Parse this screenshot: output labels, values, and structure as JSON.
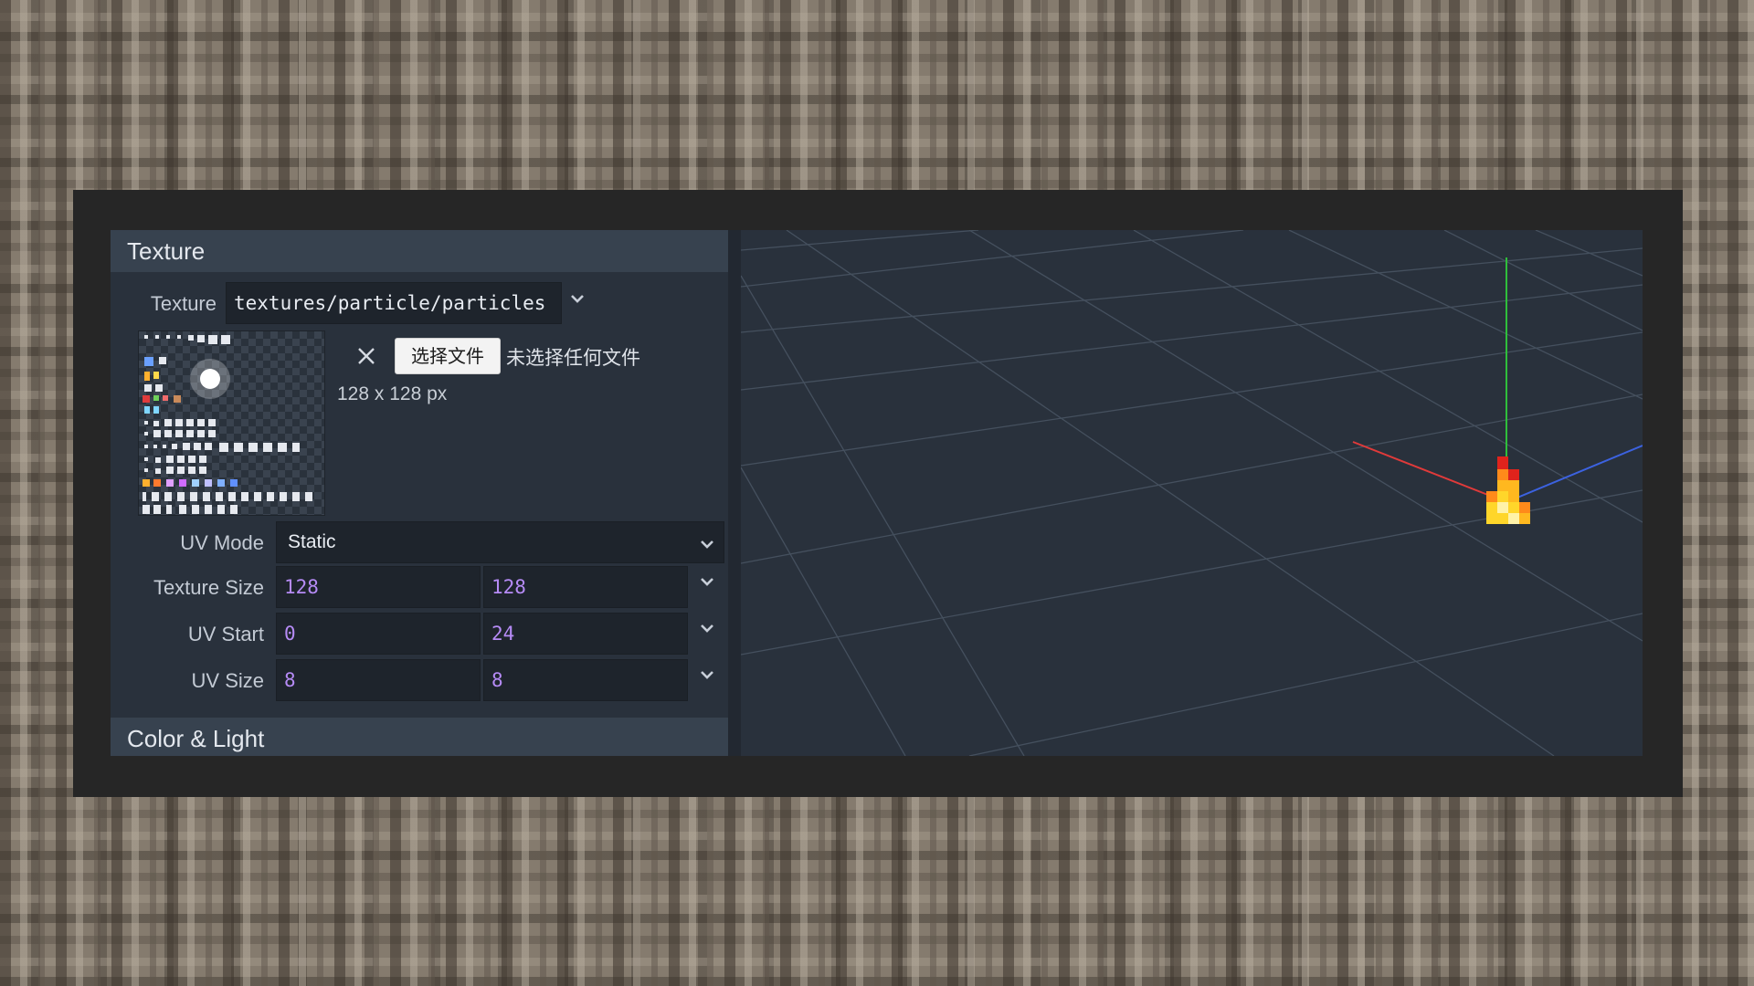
{
  "panel": {
    "texture_section_title": "Texture",
    "color_section_title": "Color & Light",
    "texture": {
      "label": "Texture",
      "value": "textures/particle/particles",
      "file_button": "选择文件",
      "file_status": "未选择任何文件",
      "size_text": "128 x 128 px"
    },
    "uv_mode": {
      "label": "UV Mode",
      "value": "Static"
    },
    "texture_size": {
      "label": "Texture Size",
      "x": "128",
      "y": "128"
    },
    "uv_start": {
      "label": "UV Start",
      "x": "0",
      "y": "24"
    },
    "uv_size": {
      "label": "UV Size",
      "x": "8",
      "y": "8"
    }
  },
  "icons": {
    "clear": "close-icon",
    "dropdown": "chevron-down-icon"
  },
  "colors": {
    "panel_bg": "#29313c",
    "header_bg": "#37424f",
    "number": "#b68bf6",
    "axis_x": "#e03a3a",
    "axis_y": "#2fbf3b",
    "axis_z": "#3c62e0"
  }
}
